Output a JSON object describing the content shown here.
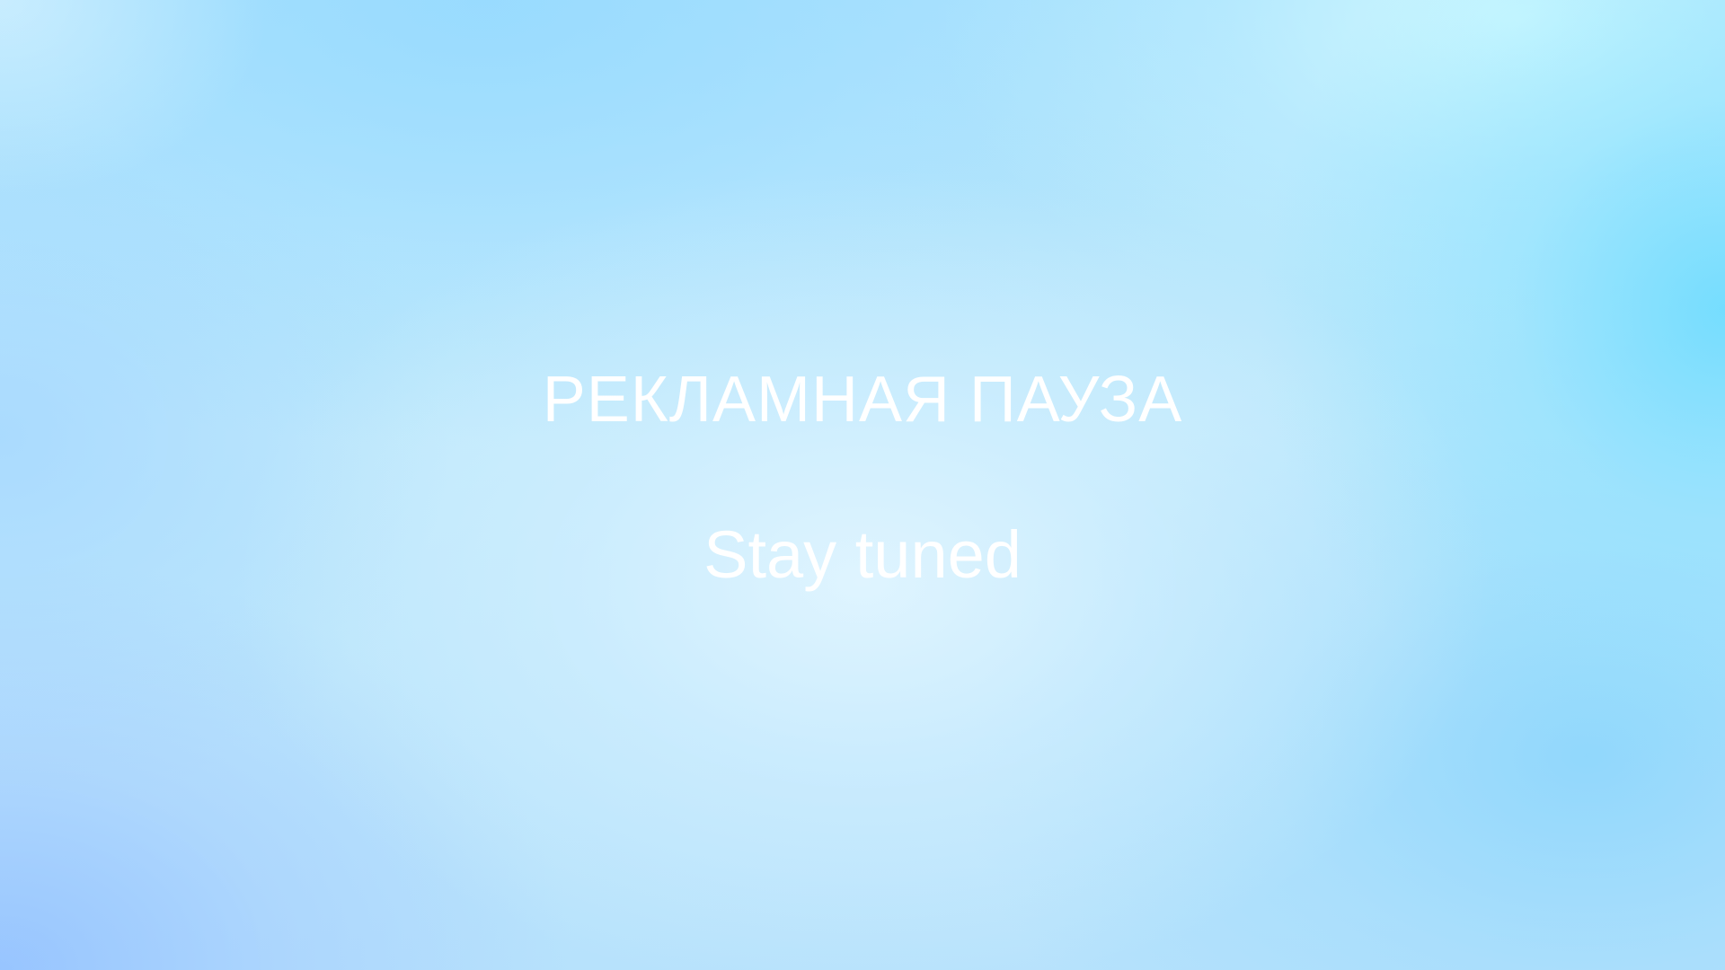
{
  "screen": {
    "headline": "РЕКЛАМНАЯ ПАУЗА",
    "subline": "Stay tuned"
  },
  "colors": {
    "text": "#ffffff",
    "background_center": "#d8f1ff",
    "background_right": "#6fdcff",
    "background_bottom_left": "#9ec4ff"
  }
}
